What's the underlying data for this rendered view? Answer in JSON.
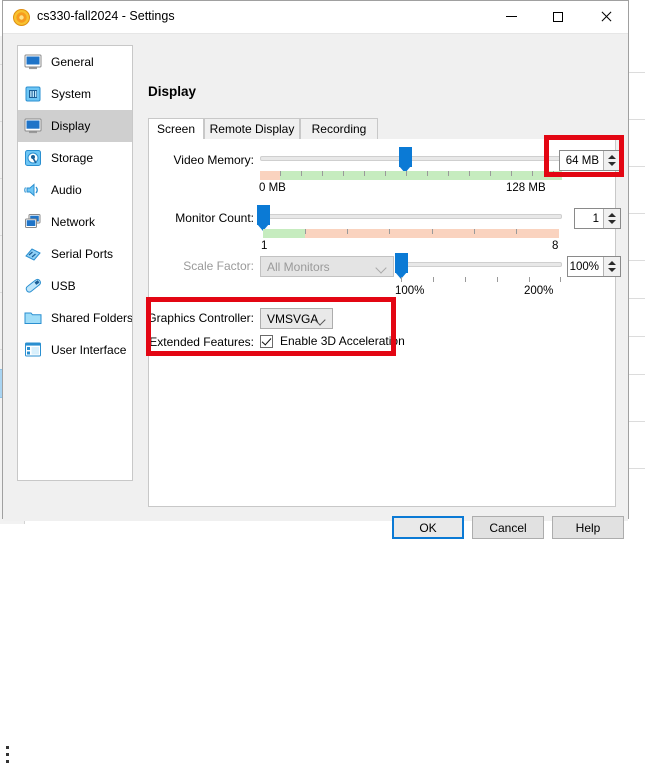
{
  "window": {
    "title": "cs330-fall2024 - Settings",
    "icon": "virtualbox-icon",
    "controls": {
      "minimize": "minimize-icon",
      "maximize": "maximize-icon",
      "close": "close-icon"
    }
  },
  "sidebar": {
    "items": [
      {
        "label": "General",
        "icon": "monitor-icon",
        "selected": false
      },
      {
        "label": "System",
        "icon": "chip-icon",
        "selected": false
      },
      {
        "label": "Display",
        "icon": "display-icon",
        "selected": true
      },
      {
        "label": "Storage",
        "icon": "harddisk-icon",
        "selected": false
      },
      {
        "label": "Audio",
        "icon": "speaker-icon",
        "selected": false
      },
      {
        "label": "Network",
        "icon": "network-icon",
        "selected": false
      },
      {
        "label": "Serial Ports",
        "icon": "serial-port-icon",
        "selected": false
      },
      {
        "label": "USB",
        "icon": "usb-icon",
        "selected": false
      },
      {
        "label": "Shared Folders",
        "icon": "folder-icon",
        "selected": false
      },
      {
        "label": "User Interface",
        "icon": "user-interface-icon",
        "selected": false
      }
    ]
  },
  "page": {
    "title": "Display",
    "tabs": [
      {
        "label": "Screen",
        "active": true
      },
      {
        "label": "Remote Display",
        "active": false
      },
      {
        "label": "Recording",
        "active": false
      }
    ]
  },
  "screen_tab": {
    "video_memory": {
      "label": "Video Memory:",
      "value": "64 MB",
      "min_label": "0 MB",
      "max_label": "128 MB",
      "highlighted": true
    },
    "monitor_count": {
      "label": "Monitor Count:",
      "value": "1",
      "min_label": "1",
      "max_label": "8",
      "highlighted": false
    },
    "scale_factor": {
      "label": "Scale Factor:",
      "monitor_select": "All Monitors",
      "monitor_select_disabled": true,
      "value": "100%",
      "min_label": "100%",
      "max_label": "200%",
      "highlighted": false
    },
    "graphics_controller": {
      "label": "Graphics Controller:",
      "value": "VMSVGA"
    },
    "extended_features": {
      "label": "Extended Features:",
      "checkbox_label": "Enable 3D Acceleration",
      "checked": true
    }
  },
  "buttons": {
    "ok": "OK",
    "cancel": "Cancel",
    "help": "Help"
  },
  "colors": {
    "accent": "#0b7ad5",
    "annotation": "#e30613",
    "slider_green": "#c6ecbf",
    "slider_salmon": "#fad3bf",
    "selected_row": "#cfcfcf"
  }
}
